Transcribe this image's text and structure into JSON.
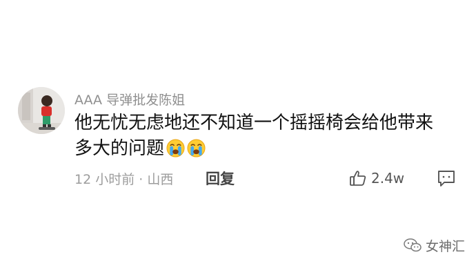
{
  "comment": {
    "avatar_icon": "child-photo-avatar",
    "username": "AAA 导弹批发陈姐",
    "text": "他无忧无虑地还不知道一个摇摇椅会给他带来多大的问题",
    "emojis": [
      "crying-face-emoji",
      "crying-face-emoji"
    ],
    "time_location": "12 小时前 · 山西",
    "reply_label": "回复",
    "like_icon": "thumbs-up-icon",
    "like_count": "2.4w",
    "comment_icon": "comment-bubble-icon"
  },
  "watermark": {
    "icon": "wechat-icon",
    "text": "女神汇"
  },
  "colors": {
    "username": "#8f8f8f",
    "text": "#111111",
    "meta": "#9c9c9c",
    "emoji_face": "#ffcc33",
    "emoji_tears": "#45a9f0"
  }
}
